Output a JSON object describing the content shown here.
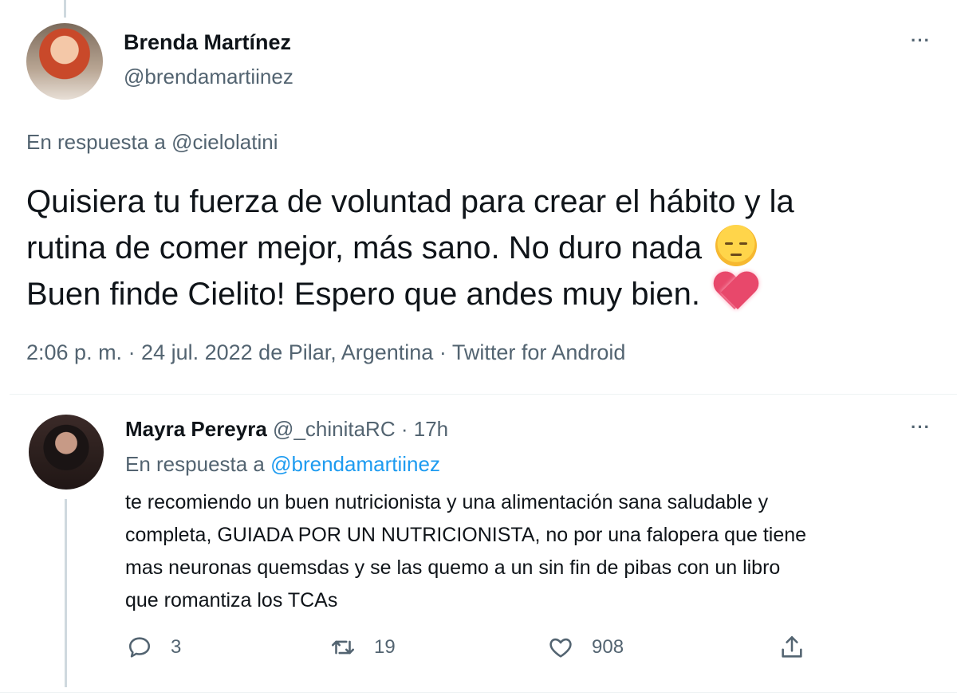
{
  "main_tweet": {
    "author": {
      "name": "Brenda Martínez",
      "handle": "@brendamartiinez"
    },
    "reply_to_label": "En respuesta a",
    "reply_to_handle": "@cielolatini",
    "text_line1": "Quisiera tu fuerza de voluntad para crear el hábito y la",
    "text_line2": "rutina de comer mejor, más sano. No duro nada",
    "text_line3": "Buen finde Cielito! Espero que andes muy bien.",
    "emoji1": "pensive-face-emoji",
    "emoji2": "heart-emoji",
    "meta": "2:06 p. m. · 24 jul. 2022 de Pilar, Argentina · Twitter for Android",
    "more_label": "···"
  },
  "reply_tweet": {
    "author": {
      "name": "Mayra Pereyra",
      "handle": "@_chinitaRC"
    },
    "separator": "·",
    "time": "17h",
    "reply_to_label": "En respuesta a",
    "reply_to_handle": "@brendamartiinez",
    "text_lines": [
      "te recomiendo un buen nutricionista y una alimentación sana saludable y",
      "completa, GUIADA POR UN NUTRICIONISTA, no por una falopera que tiene",
      "mas neuronas quemsdas y se las quemo a un sin fin de pibas con un libro",
      "que romantiza los TCAs"
    ],
    "more_label": "···",
    "actions": {
      "replies": "3",
      "retweets": "19",
      "likes": "908"
    }
  },
  "colors": {
    "text_primary": "#0f1419",
    "text_secondary": "#536471",
    "link": "#1d9bf0",
    "divider": "#eff3f4",
    "thread_line": "#cfd9de"
  }
}
